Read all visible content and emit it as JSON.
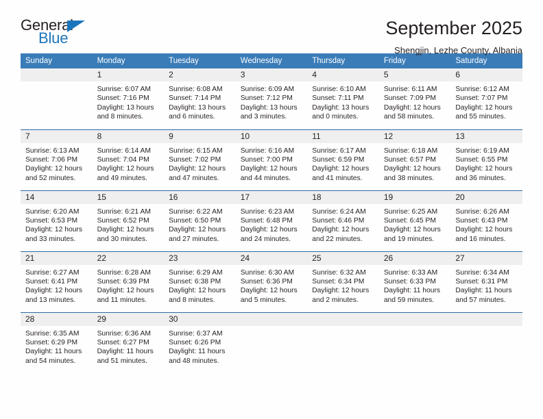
{
  "logo": {
    "text_top": "General",
    "text_bottom": "Blue",
    "triangle_color": "#1b75bb",
    "top_color": "#231f20"
  },
  "header": {
    "title": "September 2025",
    "subtitle": "Shengjin, Lezhe County, Albania"
  },
  "theme": {
    "header_bg": "#3a7cb8",
    "header_text": "#ffffff",
    "daynum_bg": "#efefef",
    "row_divider": "#2b6ca3",
    "body_text": "#231f20"
  },
  "weekday_headers": [
    "Sunday",
    "Monday",
    "Tuesday",
    "Wednesday",
    "Thursday",
    "Friday",
    "Saturday"
  ],
  "weeks": [
    [
      {
        "day": "",
        "lines": []
      },
      {
        "day": "1",
        "lines": [
          "Sunrise: 6:07 AM",
          "Sunset: 7:16 PM",
          "Daylight: 13 hours",
          "and 8 minutes."
        ]
      },
      {
        "day": "2",
        "lines": [
          "Sunrise: 6:08 AM",
          "Sunset: 7:14 PM",
          "Daylight: 13 hours",
          "and 6 minutes."
        ]
      },
      {
        "day": "3",
        "lines": [
          "Sunrise: 6:09 AM",
          "Sunset: 7:12 PM",
          "Daylight: 13 hours",
          "and 3 minutes."
        ]
      },
      {
        "day": "4",
        "lines": [
          "Sunrise: 6:10 AM",
          "Sunset: 7:11 PM",
          "Daylight: 13 hours",
          "and 0 minutes."
        ]
      },
      {
        "day": "5",
        "lines": [
          "Sunrise: 6:11 AM",
          "Sunset: 7:09 PM",
          "Daylight: 12 hours",
          "and 58 minutes."
        ]
      },
      {
        "day": "6",
        "lines": [
          "Sunrise: 6:12 AM",
          "Sunset: 7:07 PM",
          "Daylight: 12 hours",
          "and 55 minutes."
        ]
      }
    ],
    [
      {
        "day": "7",
        "lines": [
          "Sunrise: 6:13 AM",
          "Sunset: 7:06 PM",
          "Daylight: 12 hours",
          "and 52 minutes."
        ]
      },
      {
        "day": "8",
        "lines": [
          "Sunrise: 6:14 AM",
          "Sunset: 7:04 PM",
          "Daylight: 12 hours",
          "and 49 minutes."
        ]
      },
      {
        "day": "9",
        "lines": [
          "Sunrise: 6:15 AM",
          "Sunset: 7:02 PM",
          "Daylight: 12 hours",
          "and 47 minutes."
        ]
      },
      {
        "day": "10",
        "lines": [
          "Sunrise: 6:16 AM",
          "Sunset: 7:00 PM",
          "Daylight: 12 hours",
          "and 44 minutes."
        ]
      },
      {
        "day": "11",
        "lines": [
          "Sunrise: 6:17 AM",
          "Sunset: 6:59 PM",
          "Daylight: 12 hours",
          "and 41 minutes."
        ]
      },
      {
        "day": "12",
        "lines": [
          "Sunrise: 6:18 AM",
          "Sunset: 6:57 PM",
          "Daylight: 12 hours",
          "and 38 minutes."
        ]
      },
      {
        "day": "13",
        "lines": [
          "Sunrise: 6:19 AM",
          "Sunset: 6:55 PM",
          "Daylight: 12 hours",
          "and 36 minutes."
        ]
      }
    ],
    [
      {
        "day": "14",
        "lines": [
          "Sunrise: 6:20 AM",
          "Sunset: 6:53 PM",
          "Daylight: 12 hours",
          "and 33 minutes."
        ]
      },
      {
        "day": "15",
        "lines": [
          "Sunrise: 6:21 AM",
          "Sunset: 6:52 PM",
          "Daylight: 12 hours",
          "and 30 minutes."
        ]
      },
      {
        "day": "16",
        "lines": [
          "Sunrise: 6:22 AM",
          "Sunset: 6:50 PM",
          "Daylight: 12 hours",
          "and 27 minutes."
        ]
      },
      {
        "day": "17",
        "lines": [
          "Sunrise: 6:23 AM",
          "Sunset: 6:48 PM",
          "Daylight: 12 hours",
          "and 24 minutes."
        ]
      },
      {
        "day": "18",
        "lines": [
          "Sunrise: 6:24 AM",
          "Sunset: 6:46 PM",
          "Daylight: 12 hours",
          "and 22 minutes."
        ]
      },
      {
        "day": "19",
        "lines": [
          "Sunrise: 6:25 AM",
          "Sunset: 6:45 PM",
          "Daylight: 12 hours",
          "and 19 minutes."
        ]
      },
      {
        "day": "20",
        "lines": [
          "Sunrise: 6:26 AM",
          "Sunset: 6:43 PM",
          "Daylight: 12 hours",
          "and 16 minutes."
        ]
      }
    ],
    [
      {
        "day": "21",
        "lines": [
          "Sunrise: 6:27 AM",
          "Sunset: 6:41 PM",
          "Daylight: 12 hours",
          "and 13 minutes."
        ]
      },
      {
        "day": "22",
        "lines": [
          "Sunrise: 6:28 AM",
          "Sunset: 6:39 PM",
          "Daylight: 12 hours",
          "and 11 minutes."
        ]
      },
      {
        "day": "23",
        "lines": [
          "Sunrise: 6:29 AM",
          "Sunset: 6:38 PM",
          "Daylight: 12 hours",
          "and 8 minutes."
        ]
      },
      {
        "day": "24",
        "lines": [
          "Sunrise: 6:30 AM",
          "Sunset: 6:36 PM",
          "Daylight: 12 hours",
          "and 5 minutes."
        ]
      },
      {
        "day": "25",
        "lines": [
          "Sunrise: 6:32 AM",
          "Sunset: 6:34 PM",
          "Daylight: 12 hours",
          "and 2 minutes."
        ]
      },
      {
        "day": "26",
        "lines": [
          "Sunrise: 6:33 AM",
          "Sunset: 6:33 PM",
          "Daylight: 11 hours",
          "and 59 minutes."
        ]
      },
      {
        "day": "27",
        "lines": [
          "Sunrise: 6:34 AM",
          "Sunset: 6:31 PM",
          "Daylight: 11 hours",
          "and 57 minutes."
        ]
      }
    ],
    [
      {
        "day": "28",
        "lines": [
          "Sunrise: 6:35 AM",
          "Sunset: 6:29 PM",
          "Daylight: 11 hours",
          "and 54 minutes."
        ]
      },
      {
        "day": "29",
        "lines": [
          "Sunrise: 6:36 AM",
          "Sunset: 6:27 PM",
          "Daylight: 11 hours",
          "and 51 minutes."
        ]
      },
      {
        "day": "30",
        "lines": [
          "Sunrise: 6:37 AM",
          "Sunset: 6:26 PM",
          "Daylight: 11 hours",
          "and 48 minutes."
        ]
      },
      {
        "day": "",
        "lines": []
      },
      {
        "day": "",
        "lines": []
      },
      {
        "day": "",
        "lines": []
      },
      {
        "day": "",
        "lines": []
      }
    ]
  ]
}
